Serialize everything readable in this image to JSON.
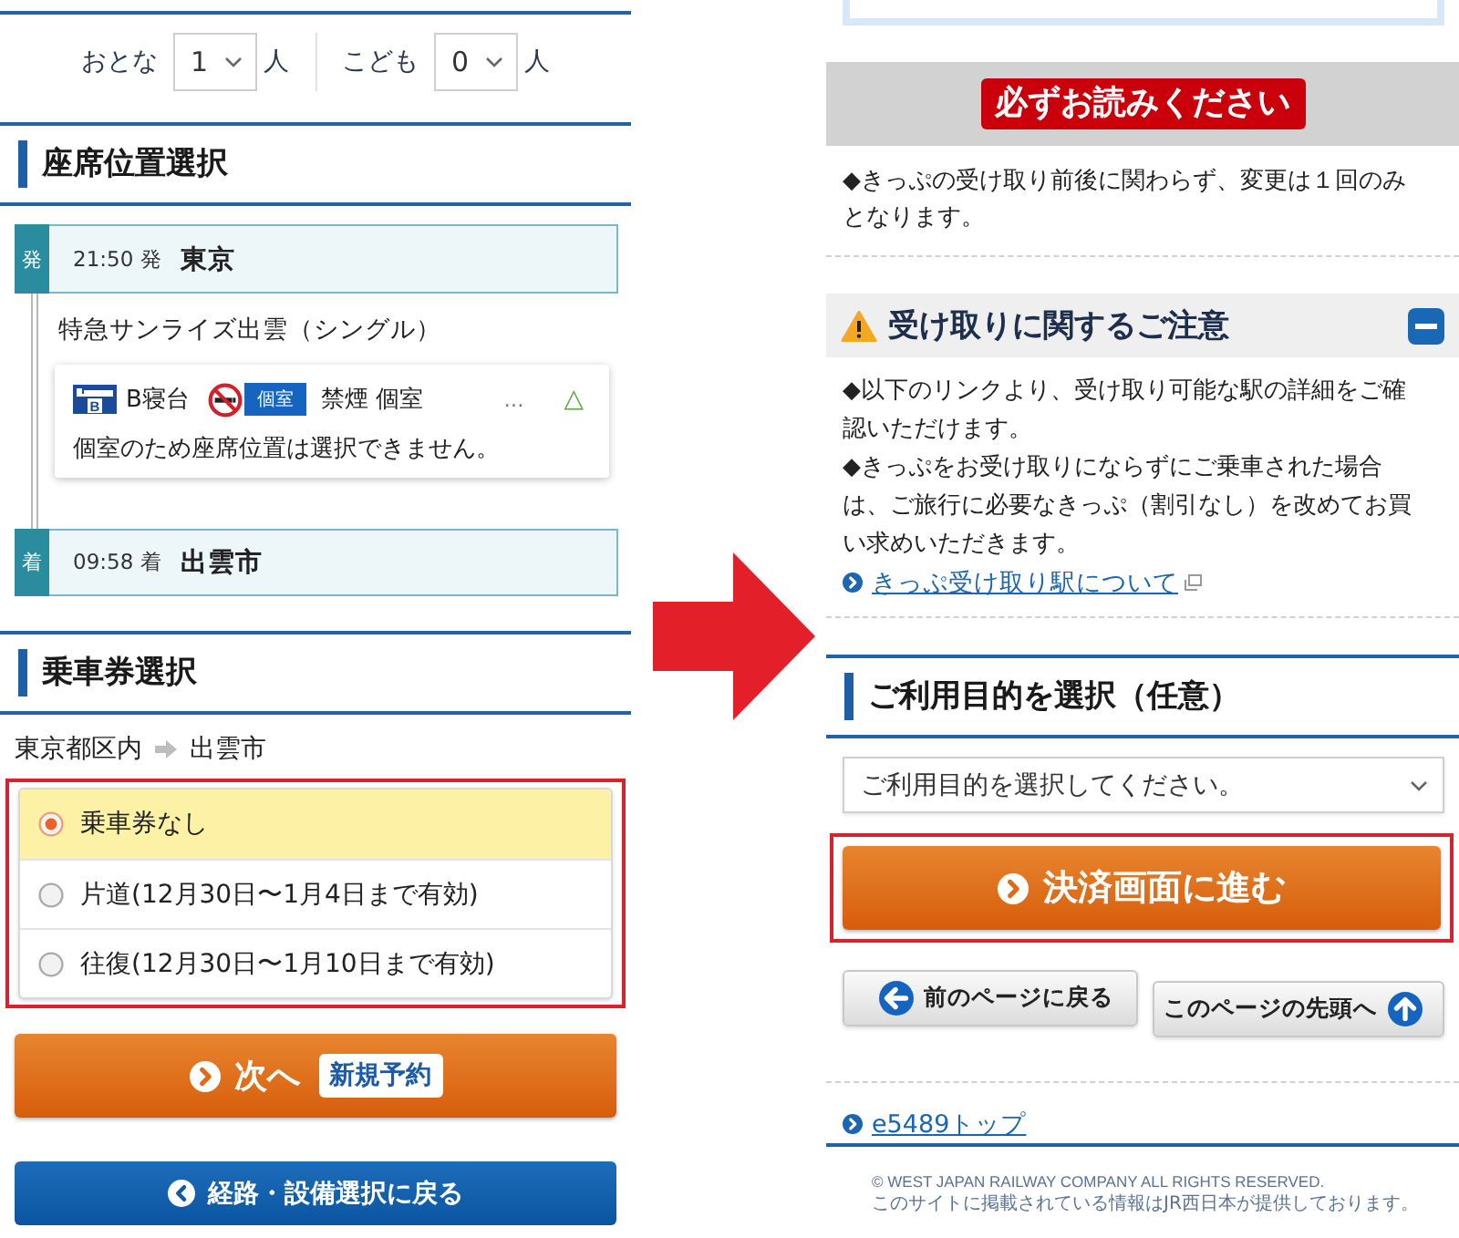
{
  "left_screen": {
    "passengers": [
      {
        "label": "おとな",
        "value": "1",
        "unit": "人"
      },
      {
        "label": "こども",
        "value": "0",
        "unit": "人"
      }
    ],
    "seat_section": {
      "heading": "座席位置選択",
      "departure": {
        "tag": "発",
        "time": "21:50 発",
        "station": "東京"
      },
      "train": "特急サンライズ出雲（シングル）",
      "seat_card": {
        "berth_icon_text": "B",
        "berth_class": "B寝台",
        "room_badge": "個室",
        "room_type": "禁煙 個室",
        "more": "…",
        "availability": "△",
        "note": "個室のため座席位置は選択できません。"
      },
      "arrival": {
        "tag": "着",
        "time": "09:58 着",
        "station": "出雲市"
      }
    },
    "ticket_section": {
      "heading": "乗車券選択",
      "route_from": "東京都区内",
      "route_to": "出雲市",
      "highlighted": true,
      "options": [
        {
          "label": "乗車券なし",
          "selected": true
        },
        {
          "label": "片道(12月30日〜1月4日まで有効)",
          "selected": false
        },
        {
          "label": "往復(12月30日〜1月10日まで有効)",
          "selected": false
        }
      ]
    },
    "next_button": {
      "label": "次へ",
      "badge": "新規予約"
    },
    "back_button": {
      "label": "経路・設備選択に戻る"
    }
  },
  "right_screen": {
    "notice_banner": "必ずお読みください",
    "notice_text": "◆きっぷの受け取り前後に関わらず、変更は１回のみとなります。",
    "pickup_notice": {
      "title": "受け取りに関するご注意",
      "expanded": true,
      "paragraphs": [
        "◆以下のリンクより、受け取り可能な駅の詳細をご確認いただけます。",
        "◆きっぷをお受け取りにならずにご乗車された場合は、ご旅行に必要なきっぷ（割引なし）を改めてお買い求めいただきます。"
      ],
      "link": "きっぷ受け取り駅について"
    },
    "purpose_section": {
      "heading": "ご利用目的を選択（任意）",
      "select": {
        "placeholder": "ご利用目的を選択してください。"
      }
    },
    "pay_button": {
      "label": "決済画面に進む",
      "highlighted": true
    },
    "nav_buttons": [
      {
        "kind": "back",
        "label": "前のページに戻る"
      },
      {
        "kind": "top",
        "label": "このページの先頭へ"
      }
    ],
    "top_link": "e5489トップ",
    "footer": {
      "copyright": "© WEST JAPAN RAILWAY COMPANY ALL RIGHTS RESERVED.",
      "notice": "このサイトに掲載されている情報はJR西日本が提供しております。"
    }
  }
}
